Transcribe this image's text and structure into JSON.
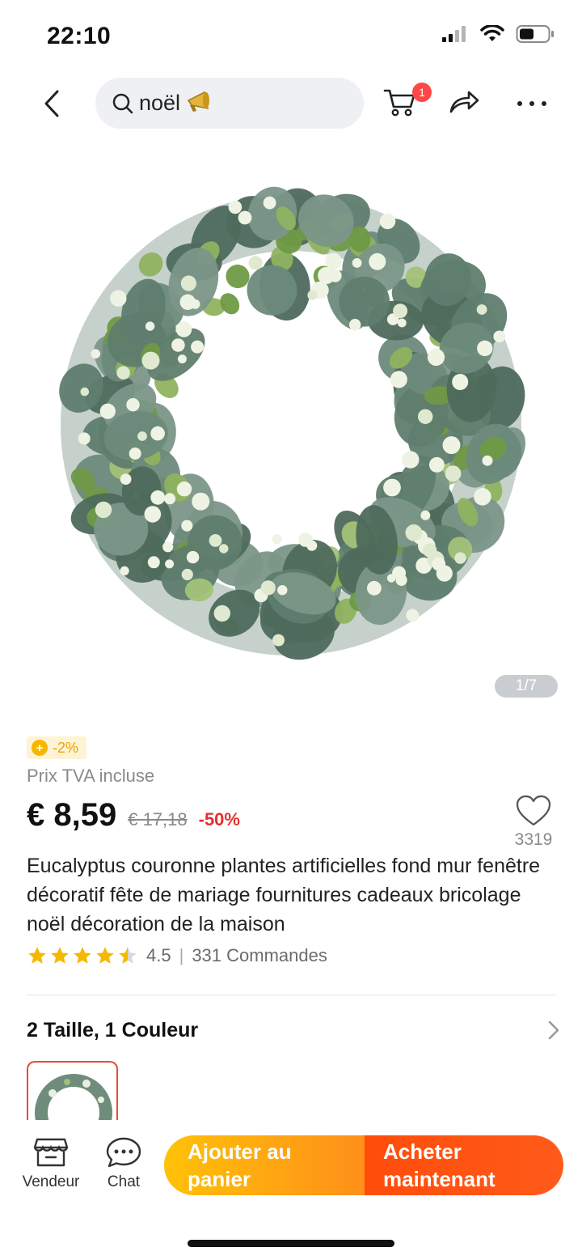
{
  "status_bar": {
    "time": "22:10"
  },
  "nav": {
    "search_query": "noël",
    "search_emoji": "📯",
    "cart_count": "1"
  },
  "gallery": {
    "counter": "1/7"
  },
  "product": {
    "coin_discount": "-2%",
    "tax_note": "Prix TVA incluse",
    "price": "€ 8,59",
    "old_price": "€ 17,18",
    "discount": "-50%",
    "wishlist_count": "3319",
    "title": "Eucalyptus couronne plantes artificielles fond mur fenêtre décoratif fête de mariage fournitures cadeaux bricolage noël décoration de la maison",
    "rating": "4.5",
    "rating_value": 4.5,
    "orders": "331 Commandes"
  },
  "variants": {
    "label": "2 Taille, 1 Couleur"
  },
  "bottom_bar": {
    "vendor_label": "Vendeur",
    "chat_label": "Chat",
    "add_to_cart": "Ajouter au panier",
    "buy_now": "Acheter maintenant"
  },
  "colors": {
    "accent_red": "#ff4747",
    "price_discount": "#e62e2e",
    "star": "#f5b800",
    "cta_cart": "#ffa60d",
    "cta_buy": "#ff4d0a"
  }
}
